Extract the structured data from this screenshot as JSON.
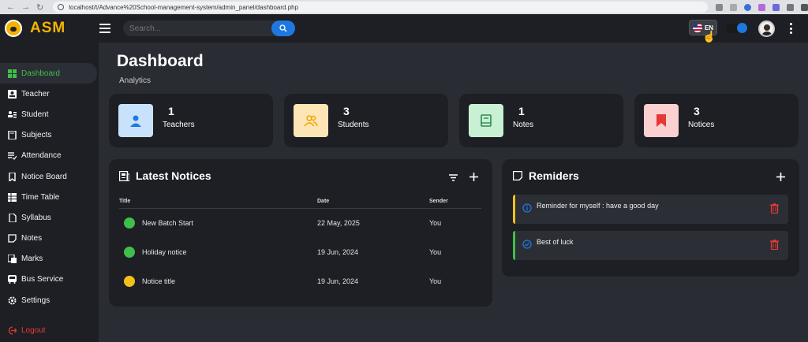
{
  "browser": {
    "url": "localhost/t/Advance%20School-management-system/admin_panel/dashboard.php"
  },
  "header": {
    "brand": "ASM",
    "search_placeholder": "Search...",
    "language": "EN"
  },
  "sidebar": {
    "items": [
      {
        "label": "Dashboard",
        "icon": "dashboard-icon",
        "active": true
      },
      {
        "label": "Teacher",
        "icon": "teacher-icon"
      },
      {
        "label": "Student",
        "icon": "student-icon"
      },
      {
        "label": "Subjects",
        "icon": "book-icon"
      },
      {
        "label": "Attendance",
        "icon": "attendance-icon"
      },
      {
        "label": "Notice Board",
        "icon": "bookmark-icon"
      },
      {
        "label": "Time Table",
        "icon": "table-icon"
      },
      {
        "label": "Syllabus",
        "icon": "document-icon"
      },
      {
        "label": "Notes",
        "icon": "note-icon"
      },
      {
        "label": "Marks",
        "icon": "marks-icon"
      },
      {
        "label": "Bus Service",
        "icon": "bus-icon"
      },
      {
        "label": "Settings",
        "icon": "gear-icon"
      }
    ],
    "logout": "Logout"
  },
  "main": {
    "title": "Dashboard",
    "subtitle": "Analytics",
    "cards": [
      {
        "value": "1",
        "label": "Teachers",
        "color": "#c9e2fb",
        "icon_color": "#1f78e0"
      },
      {
        "value": "3",
        "label": "Students",
        "color": "#fde5b5",
        "icon_color": "#f2a500"
      },
      {
        "value": "1",
        "label": "Notes",
        "color": "#c8f0d3",
        "icon_color": "#2e8b57"
      },
      {
        "value": "3",
        "label": "Notices",
        "color": "#fbd0d0",
        "icon_color": "#e53935"
      }
    ],
    "notices": {
      "title": "Latest Notices",
      "headers": {
        "title": "Title",
        "date": "Date",
        "sender": "Sender"
      },
      "rows": [
        {
          "title": "New Batch Start",
          "date": "22 May, 2025",
          "sender": "You",
          "color": "#3fbf4a"
        },
        {
          "title": "Holiday notice",
          "date": "19 Jun, 2024",
          "sender": "You",
          "color": "#3fbf4a"
        },
        {
          "title": "Notice title",
          "date": "19 Jun, 2024",
          "sender": "You",
          "color": "#f2c01a"
        }
      ]
    },
    "reminders": {
      "title": "Remiders",
      "items": [
        {
          "text": "Reminder for myself : have a good day",
          "color": "#f2c01a",
          "icon": "info-icon"
        },
        {
          "text": "Best of luck",
          "color": "#3fbf4a",
          "icon": "check-circle-icon"
        }
      ]
    }
  }
}
